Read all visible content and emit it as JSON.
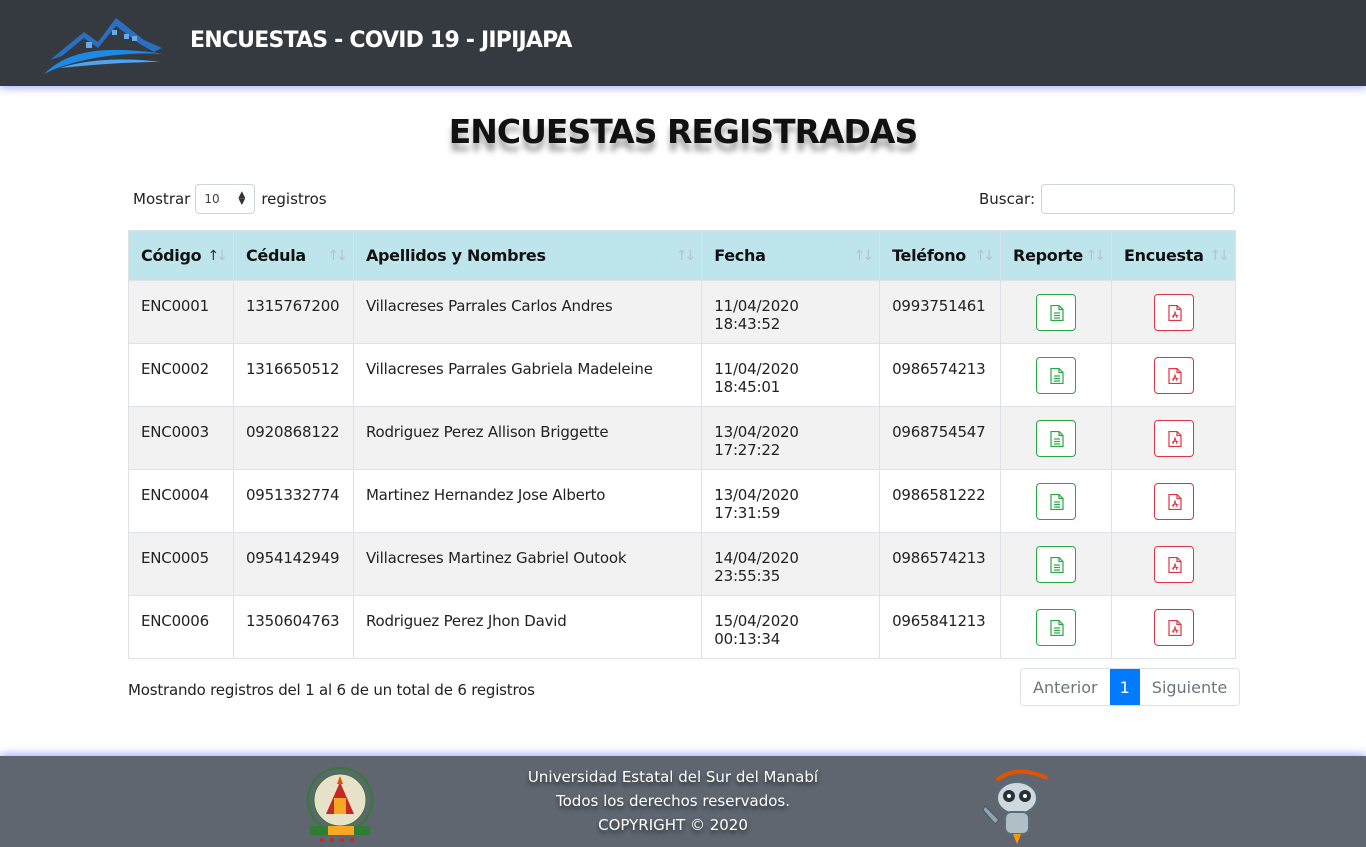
{
  "header": {
    "brand": "ENCUESTAS - COVID 19 - JIPIJAPA",
    "logo_icon": "house-wave-logo-icon"
  },
  "page": {
    "title": "ENCUESTAS REGISTRADAS"
  },
  "controls": {
    "show_label": "Mostrar",
    "page_size": "10",
    "records_label": "registros",
    "search_label": "Buscar:",
    "search_value": ""
  },
  "table": {
    "headers": [
      "Código",
      "Cédula",
      "Apellidos y Nombres",
      "Fecha",
      "Teléfono",
      "Reporte",
      "Encuesta"
    ],
    "rows": [
      {
        "code": "ENC0001",
        "id": "1315767200",
        "name": "Villacreses Parrales Carlos Andres",
        "date": "11/04/2020 18:43:52",
        "phone": "0993751461"
      },
      {
        "code": "ENC0002",
        "id": "1316650512",
        "name": "Villacreses Parrales Gabriela Madeleine",
        "date": "11/04/2020 18:45:01",
        "phone": "0986574213"
      },
      {
        "code": "ENC0003",
        "id": "0920868122",
        "name": "Rodriguez Perez Allison Briggette",
        "date": "13/04/2020 17:27:22",
        "phone": "0968754547"
      },
      {
        "code": "ENC0004",
        "id": "0951332774",
        "name": "Martinez Hernandez Jose Alberto",
        "date": "13/04/2020 17:31:59",
        "phone": "0986581222"
      },
      {
        "code": "ENC0005",
        "id": "0954142949",
        "name": "Villacreses Martinez Gabriel Outook",
        "date": "14/04/2020 23:55:35",
        "phone": "0986574213"
      },
      {
        "code": "ENC0006",
        "id": "1350604763",
        "name": "Rodriguez Perez Jhon David",
        "date": "15/04/2020 00:13:34",
        "phone": "0965841213"
      }
    ],
    "report_icon": "file-text-icon",
    "survey_icon": "file-pdf-icon"
  },
  "summary": {
    "info": "Mostrando registros del 1 al 6 de un total de 6 registros"
  },
  "pagination": {
    "prev": "Anterior",
    "current": "1",
    "next": "Siguiente"
  },
  "footer": {
    "line1": "Universidad Estatal del Sur del Manabí",
    "line2": "Todos los derechos reservados.",
    "line3": "COPYRIGHT © 2020",
    "seal_icon": "university-seal-icon",
    "robot_icon": "robot-mascot-icon"
  },
  "colors": {
    "header_bg": "#343a40",
    "table_header_bg": "#bee5eb",
    "report_green": "#28a745",
    "pdf_red": "#dc3545",
    "page_active": "#007bff",
    "footer_bg": "#5f6670"
  }
}
